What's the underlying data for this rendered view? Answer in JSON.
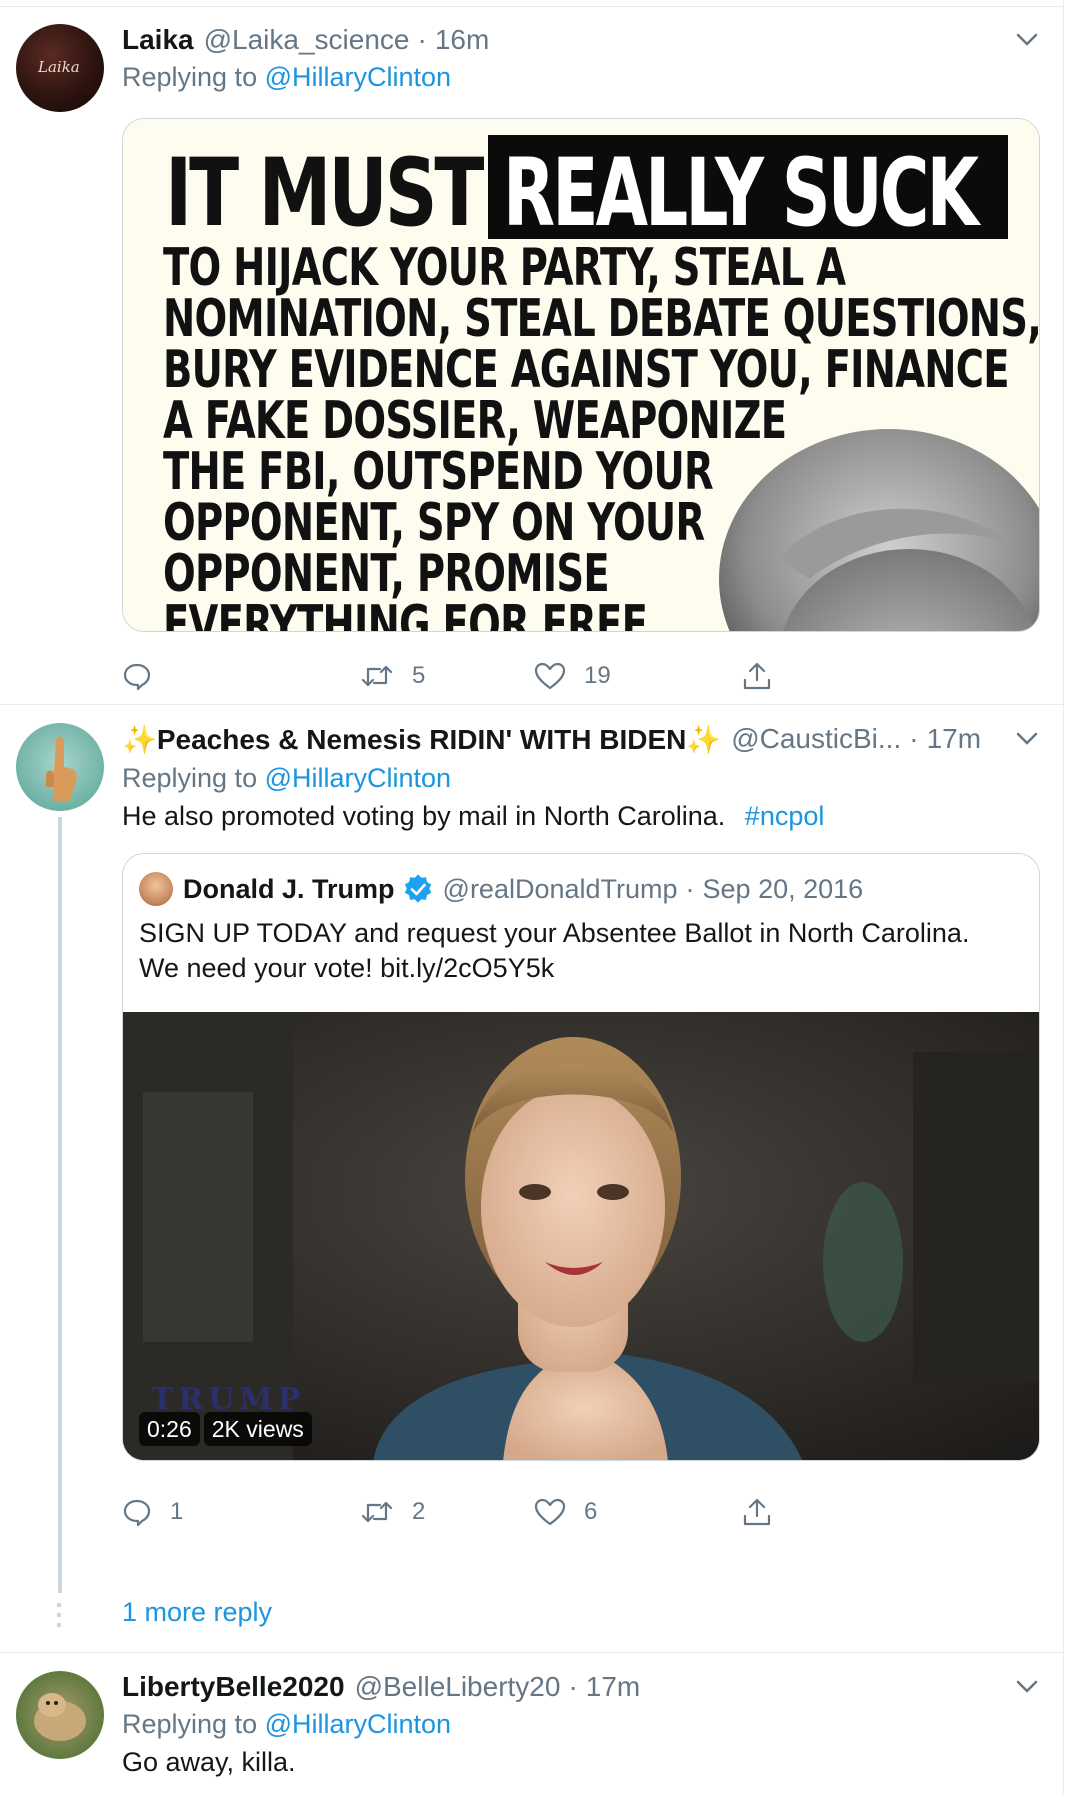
{
  "tweets": [
    {
      "name": "Laika",
      "handle": "@Laika_science",
      "time": "16m",
      "replying_prefix": "Replying to",
      "replying_to": "@HillaryClinton",
      "avatar_text": "Laika",
      "meme": {
        "line1": "IT MUST",
        "line1_highlight": "REALLY SUCK",
        "body": "TO HIJACK YOUR PARTY, STEAL A\nNOMINATION, STEAL DEBATE QUESTIONS,\nBURY EVIDENCE AGAINST YOU, FINANCE\nA FAKE DOSSIER, WEAPONIZE\nTHE FBI, OUTSPEND YOUR\nOPPONENT, SPY ON YOUR\nOPPONENT, PROMISE\nEVERYTHING FOR FREE"
      },
      "actions": {
        "reply": "",
        "retweet": "5",
        "like": "19"
      }
    },
    {
      "name": "✨Peaches & Nemesis RIDIN' WITH BIDEN✨",
      "handle": "@CausticBi...",
      "time": "17m",
      "replying_prefix": "Replying to",
      "replying_to": "@HillaryClinton",
      "text": "He also promoted voting by mail in North Carolina.",
      "hashtag": "#ncpol",
      "quote": {
        "name": "Donald J. Trump",
        "handle": "@realDonaldTrump",
        "date": "Sep 20, 2016",
        "line1": "SIGN UP TODAY and request your Absentee Ballot in North Carolina.",
        "line2": "We need your vote! bit.ly/2cO5Y5k",
        "video_logo": "TRUMP",
        "duration": "0:26",
        "views": "2K views"
      },
      "actions": {
        "reply": "1",
        "retweet": "2",
        "like": "6"
      },
      "more_replies": "1 more reply"
    },
    {
      "name": "LibertyBelle2020",
      "handle": "@BelleLiberty20",
      "time": "17m",
      "replying_prefix": "Replying to",
      "replying_to": "@HillaryClinton",
      "text": "Go away, killa."
    }
  ],
  "separator": "·",
  "icons": [
    "chevron-down-icon",
    "reply-icon",
    "retweet-icon",
    "like-icon",
    "share-icon",
    "verified-badge-icon"
  ],
  "colors": {
    "link": "#1b95e0",
    "secondary": "#657786",
    "border": "#e6ecf0",
    "text": "#14171a",
    "verified": "#1da1f2"
  }
}
